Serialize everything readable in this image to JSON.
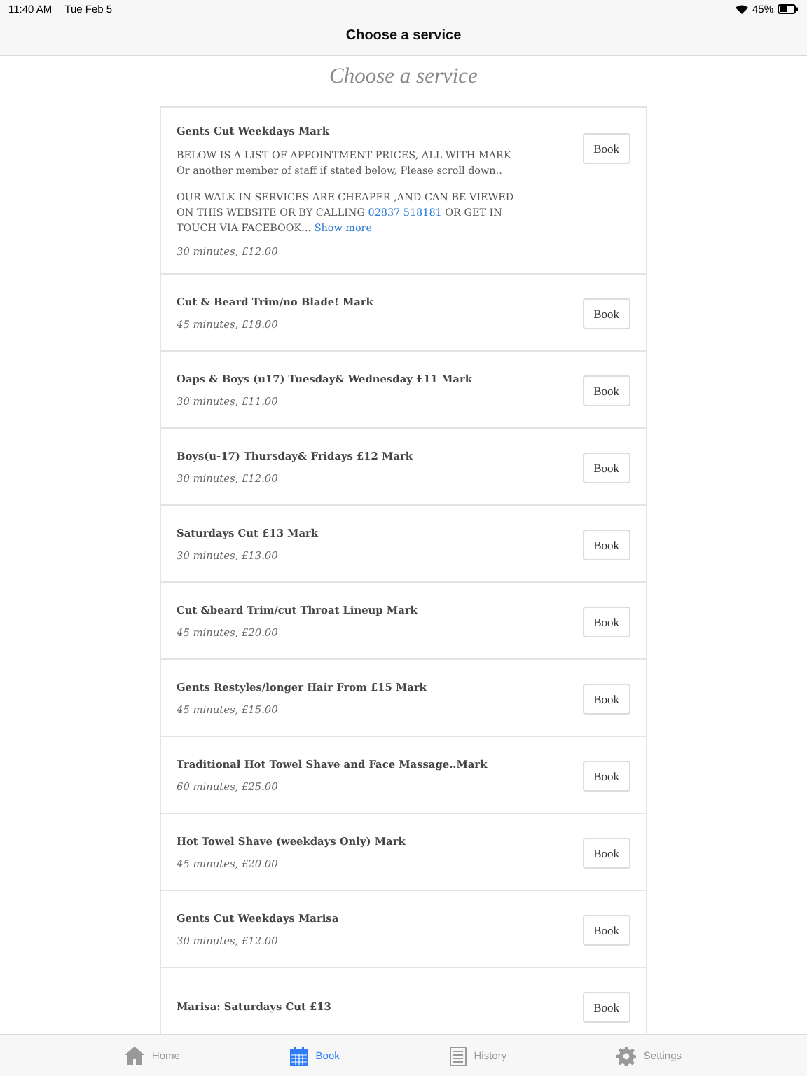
{
  "status_bar": {
    "time": "11:40 AM",
    "date": "Tue Feb 5",
    "battery": "45%"
  },
  "nav_bar": {
    "title": "Choose a service"
  },
  "heading": "Choose a service",
  "services": [
    {
      "name": "Gents Cut Weekdays Mark",
      "description": [
        {
          "parts": [
            {
              "kind": "text",
              "text": "BELOW IS A LIST OF APPOINTMENT PRICES, ALL WITH MARK Or another member of staff if stated below, Please scroll down.."
            }
          ]
        },
        {
          "parts": [
            {
              "kind": "text",
              "text": "OUR WALK IN SERVICES ARE CHEAPER ,AND CAN BE VIEWED ON THIS WEBSITE OR BY CALLING "
            },
            {
              "kind": "link",
              "text": "02837 518181"
            },
            {
              "kind": "text",
              "text": " OR GET IN TOUCH VIA FACEBOOK... "
            },
            {
              "kind": "link",
              "text": "Show more"
            }
          ]
        }
      ],
      "details": "30 minutes, £12.00",
      "button": "Book"
    },
    {
      "name": "Cut & Beard Trim/no Blade! Mark",
      "details": "45 minutes, £18.00",
      "button": "Book"
    },
    {
      "name": "Oaps & Boys (u17) Tuesday& Wednesday £11 Mark",
      "details": "30 minutes, £11.00",
      "button": "Book"
    },
    {
      "name": "Boys(u-17) Thursday& Fridays £12 Mark",
      "details": "30 minutes, £12.00",
      "button": "Book"
    },
    {
      "name": "Saturdays Cut £13 Mark",
      "details": "30 minutes, £13.00",
      "button": "Book"
    },
    {
      "name": "Cut &beard Trim/cut Throat Lineup Mark",
      "details": "45 minutes, £20.00",
      "button": "Book"
    },
    {
      "name": "Gents Restyles/longer Hair From £15 Mark",
      "details": "45 minutes, £15.00",
      "button": "Book"
    },
    {
      "name": "Traditional Hot Towel Shave and Face Massage..Mark",
      "details": "60 minutes, £25.00",
      "button": "Book"
    },
    {
      "name": "Hot Towel Shave (weekdays Only) Mark",
      "details": "45 minutes, £20.00",
      "button": "Book"
    },
    {
      "name": "Gents Cut Weekdays Marisa",
      "details": "30 minutes, £12.00",
      "button": "Book"
    },
    {
      "name": "Marisa: Saturdays Cut £13",
      "button": "Book"
    }
  ],
  "tab_bar": [
    {
      "kind": "home",
      "label": "Home",
      "selected": false
    },
    {
      "kind": "book",
      "label": "Book",
      "selected": true
    },
    {
      "kind": "history",
      "label": "History",
      "selected": false
    },
    {
      "kind": "settings",
      "label": "Settings",
      "selected": false
    }
  ]
}
